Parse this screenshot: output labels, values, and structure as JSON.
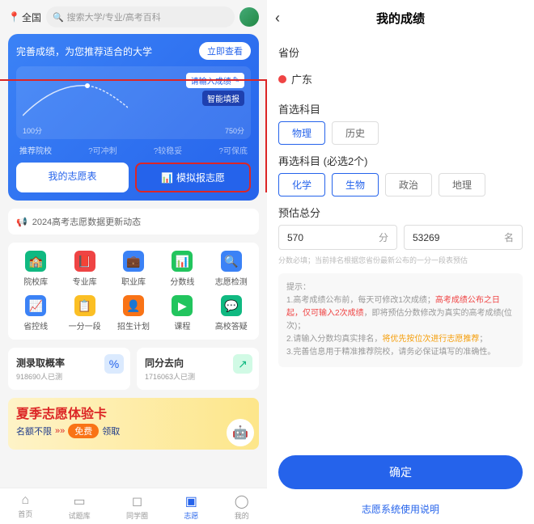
{
  "left": {
    "location": "全国",
    "search_placeholder": "搜索大学/专业/高考百科",
    "hero": {
      "title": "完善成绩，为您推荐适合的大学",
      "cta": "立即查看",
      "input_label": "请输入成绩",
      "smart_label": "智能填报",
      "min_label": "100分",
      "max_label": "750分",
      "rec_label": "推荐院校",
      "rec1": "?可冲刺",
      "rec2": "?较稳妥",
      "rec3": "?可保底"
    },
    "tabs": {
      "my_list": "我的志愿表",
      "simulate": "模拟报志愿"
    },
    "notice": "2024高考志愿数据更新动态",
    "grid": [
      {
        "label": "院校库",
        "color": "#10b981",
        "glyph": "🏫"
      },
      {
        "label": "专业库",
        "color": "#ef4444",
        "glyph": "📕"
      },
      {
        "label": "职业库",
        "color": "#3b82f6",
        "glyph": "💼"
      },
      {
        "label": "分数线",
        "color": "#22c55e",
        "glyph": "📊"
      },
      {
        "label": "志愿检测",
        "color": "#3b82f6",
        "glyph": "🔍"
      },
      {
        "label": "省控线",
        "color": "#3b82f6",
        "glyph": "📈"
      },
      {
        "label": "一分一段",
        "color": "#fbbf24",
        "glyph": "📋"
      },
      {
        "label": "招生计划",
        "color": "#f97316",
        "glyph": "👤"
      },
      {
        "label": "课程",
        "color": "#22c55e",
        "glyph": "▶"
      },
      {
        "label": "高校答疑",
        "color": "#10b981",
        "glyph": "💬"
      }
    ],
    "cards": {
      "prob": {
        "title": "测录取概率",
        "sub": "918690人已测",
        "ic": "%",
        "bg": "#dbeafe",
        "fg": "#2563eb"
      },
      "same": {
        "title": "同分去向",
        "sub": "1716063人已测",
        "ic": "↗",
        "bg": "#d1fae5",
        "fg": "#10b981"
      }
    },
    "banner": {
      "t1": "夏季志愿体验卡",
      "t2a": "名额不限",
      "badge": "免费",
      "t2b": "领取"
    },
    "nav": [
      {
        "label": "首页",
        "glyph": "⌂"
      },
      {
        "label": "试题库",
        "glyph": "▭"
      },
      {
        "label": "同学圈",
        "glyph": "◻"
      },
      {
        "label": "志愿",
        "glyph": "▣"
      },
      {
        "label": "我的",
        "glyph": "◯"
      }
    ],
    "nav_active": 3
  },
  "right": {
    "title": "我的成绩",
    "province_label": "省份",
    "province": "广东",
    "primary_label": "首选科目",
    "primary": [
      {
        "name": "物理",
        "sel": true
      },
      {
        "name": "历史",
        "sel": false
      }
    ],
    "secondary_label": "再选科目 (必选2个)",
    "secondary": [
      {
        "name": "化学",
        "sel": true
      },
      {
        "name": "生物",
        "sel": true
      },
      {
        "name": "政治",
        "sel": false
      },
      {
        "name": "地理",
        "sel": false
      }
    ],
    "score_label": "预估总分",
    "score": {
      "points": "570",
      "points_unit": "分",
      "rank": "53269",
      "rank_unit": "名"
    },
    "hint": "分数必填；当前排名根据您省份最新公布的一分一段表预估",
    "tips_label": "提示：",
    "tip1a": "1.高考成绩公布前，每天可修改1次成绩；",
    "tip1b": "高考成绩公布之日起，仅可输入2次成绩",
    "tip1c": "，即将预估分数修改为真实的高考成绩(位次)；",
    "tip2a": "2.请输入分数均真实排名，",
    "tip2b": "将优先按位次进行志愿推荐",
    "tip2c": "；",
    "tip3": "3.完善信息用于精准推荐院校，请务必保证填写的准确性。",
    "confirm": "确定",
    "help": "志愿系统使用说明"
  }
}
